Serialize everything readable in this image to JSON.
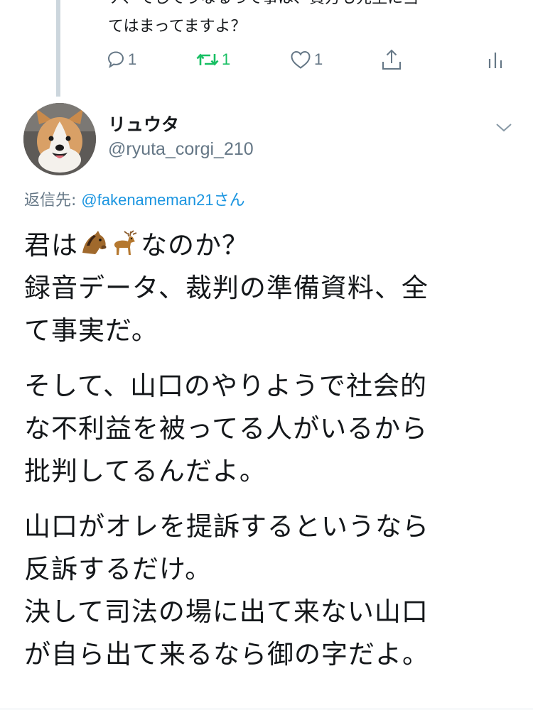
{
  "previous_tweet": {
    "partial_line": "ナ、てしてうなるって事は、貴方も先生に当",
    "last_line": "てはまってますよ？",
    "actions": {
      "reply_count": "1",
      "retweet_count": "1",
      "like_count": "1"
    }
  },
  "tweet": {
    "display_name": "リュウタ",
    "handle": "@ryuta_corgi_210",
    "reply_label": "返信先: ",
    "reply_mention": "@fakenameman21",
    "reply_suffix": "さん",
    "paragraphs": [
      [
        "君は",
        "なのか？",
        "録音データ、裁判の準備資料、全",
        "て事実だ。"
      ],
      [
        "そして、山口のやりようで社会的",
        "な不利益を被ってる人がいるから",
        "批判してるんだよ。"
      ],
      [
        "山口がオレを提訴するというなら",
        "反訴するだけ。",
        "決して司法の場に出て来ない山口",
        "が自ら出て来るなら御の字だよ。"
      ]
    ],
    "emojis": [
      "horse-emoji",
      "deer-emoji"
    ]
  },
  "colors": {
    "retweet_green": "#17bf63",
    "mention_blue": "#1b95e0",
    "secondary_gray": "#657786",
    "thread_line": "#ccd6dd"
  }
}
